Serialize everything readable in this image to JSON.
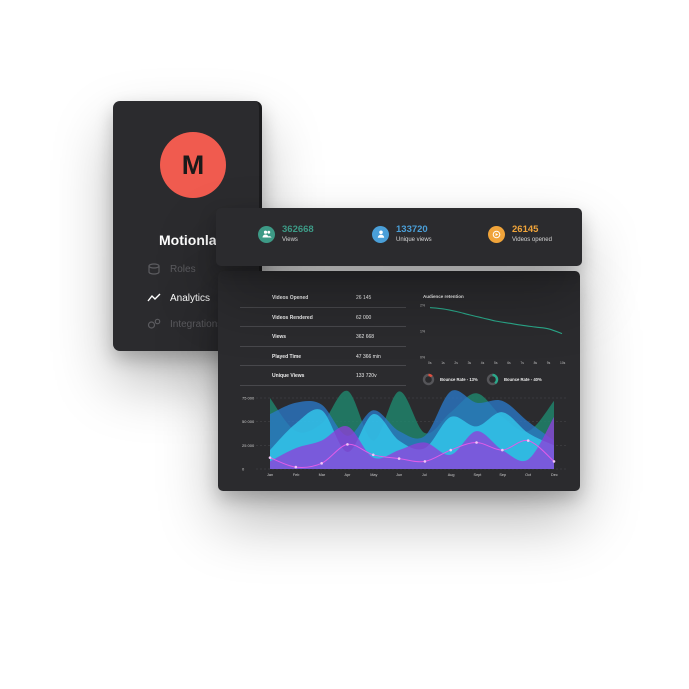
{
  "sidebar": {
    "logo_letter": "M",
    "brand": "Motionlal",
    "nav": [
      {
        "label": "Roles",
        "icon": "database-icon"
      },
      {
        "label": "Analytics",
        "icon": "trend-line-icon",
        "active": true
      },
      {
        "label": "Integrations",
        "icon": "gears-icon"
      }
    ]
  },
  "stats": [
    {
      "value": "362668",
      "label": "Views",
      "color": "#3d9a86",
      "icon": "users-icon"
    },
    {
      "value": "133720",
      "label": "Unique views",
      "color": "#4a9fd8",
      "icon": "user-icon"
    },
    {
      "value": "26145",
      "label": "Videos opened",
      "color": "#f0a43a",
      "icon": "play-circle-icon"
    }
  ],
  "table": [
    {
      "key": "Videos Opened",
      "value": "26 145"
    },
    {
      "key": "Videos Rendered",
      "value": "62 000"
    },
    {
      "key": "Views",
      "value": "362 668"
    },
    {
      "key": "Played Time",
      "value": "47 366 min"
    },
    {
      "key": "Unique Views",
      "value": "133 720v"
    }
  ],
  "retention": {
    "title": "Audience retention",
    "y_ticks": [
      "2%",
      "1%",
      "0%"
    ],
    "x_ticks": [
      "0s",
      "1s",
      "2s",
      "3s",
      "4s",
      "5s",
      "6s",
      "7s",
      "8s",
      "9s",
      "10s"
    ],
    "values": [
      1.9,
      1.85,
      1.75,
      1.62,
      1.5,
      1.38,
      1.3,
      1.22,
      1.15,
      1.08,
      0.9
    ],
    "color": "#2aa88a"
  },
  "bounce": [
    {
      "label": "Bounce Rate - 13%",
      "pct": 13,
      "color": "#e2503f"
    },
    {
      "label": "Bounce Rate - 40%",
      "pct": 40,
      "color": "#2aa88a"
    }
  ],
  "chart_data": {
    "type": "area",
    "categories": [
      "Jan",
      "Feb",
      "Mar",
      "Apr",
      "May",
      "Jun",
      "Jul",
      "Aug",
      "Sept",
      "Sep",
      "Oct",
      "Dec"
    ],
    "y_ticks": [
      "75 000",
      "50 000",
      "25 000",
      "0"
    ],
    "ylim": [
      0,
      75000
    ],
    "series": [
      {
        "color": "#1f8a70",
        "values": [
          75000,
          40000,
          48000,
          85000,
          30000,
          82000,
          38000,
          60000,
          80000,
          55000,
          40000,
          72000
        ]
      },
      {
        "color": "#2a78c8",
        "values": [
          58000,
          70000,
          68000,
          35000,
          62000,
          40000,
          35000,
          82000,
          70000,
          72000,
          50000,
          30000
        ]
      },
      {
        "color": "#33ccee",
        "values": [
          20000,
          48000,
          62000,
          18000,
          58000,
          30000,
          22000,
          55000,
          45000,
          60000,
          38000,
          25000
        ]
      },
      {
        "color": "#8e3fd8",
        "values": [
          8000,
          22000,
          30000,
          45000,
          12000,
          20000,
          28000,
          15000,
          40000,
          20000,
          10000,
          55000
        ]
      },
      {
        "color": "#e05ce8",
        "values": [
          12000,
          2000,
          6000,
          26000,
          15000,
          11000,
          8000,
          20000,
          28000,
          20000,
          30000,
          8000
        ],
        "line": true
      }
    ]
  }
}
